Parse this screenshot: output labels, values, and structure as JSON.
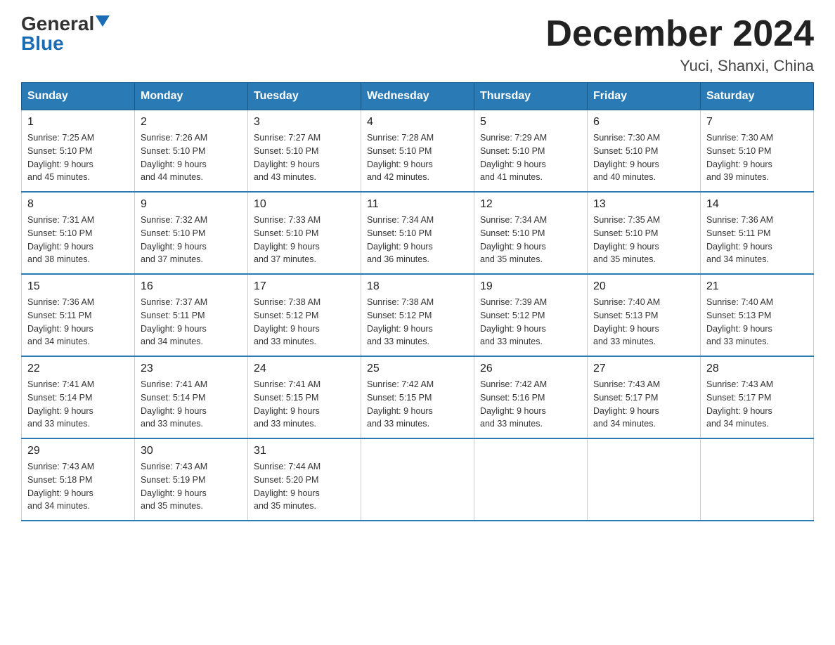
{
  "logo": {
    "general": "General",
    "blue": "Blue"
  },
  "title": {
    "month_year": "December 2024",
    "location": "Yuci, Shanxi, China"
  },
  "headers": [
    "Sunday",
    "Monday",
    "Tuesday",
    "Wednesday",
    "Thursday",
    "Friday",
    "Saturday"
  ],
  "weeks": [
    [
      {
        "day": "1",
        "sunrise": "7:25 AM",
        "sunset": "5:10 PM",
        "daylight": "9 hours and 45 minutes."
      },
      {
        "day": "2",
        "sunrise": "7:26 AM",
        "sunset": "5:10 PM",
        "daylight": "9 hours and 44 minutes."
      },
      {
        "day": "3",
        "sunrise": "7:27 AM",
        "sunset": "5:10 PM",
        "daylight": "9 hours and 43 minutes."
      },
      {
        "day": "4",
        "sunrise": "7:28 AM",
        "sunset": "5:10 PM",
        "daylight": "9 hours and 42 minutes."
      },
      {
        "day": "5",
        "sunrise": "7:29 AM",
        "sunset": "5:10 PM",
        "daylight": "9 hours and 41 minutes."
      },
      {
        "day": "6",
        "sunrise": "7:30 AM",
        "sunset": "5:10 PM",
        "daylight": "9 hours and 40 minutes."
      },
      {
        "day": "7",
        "sunrise": "7:30 AM",
        "sunset": "5:10 PM",
        "daylight": "9 hours and 39 minutes."
      }
    ],
    [
      {
        "day": "8",
        "sunrise": "7:31 AM",
        "sunset": "5:10 PM",
        "daylight": "9 hours and 38 minutes."
      },
      {
        "day": "9",
        "sunrise": "7:32 AM",
        "sunset": "5:10 PM",
        "daylight": "9 hours and 37 minutes."
      },
      {
        "day": "10",
        "sunrise": "7:33 AM",
        "sunset": "5:10 PM",
        "daylight": "9 hours and 37 minutes."
      },
      {
        "day": "11",
        "sunrise": "7:34 AM",
        "sunset": "5:10 PM",
        "daylight": "9 hours and 36 minutes."
      },
      {
        "day": "12",
        "sunrise": "7:34 AM",
        "sunset": "5:10 PM",
        "daylight": "9 hours and 35 minutes."
      },
      {
        "day": "13",
        "sunrise": "7:35 AM",
        "sunset": "5:10 PM",
        "daylight": "9 hours and 35 minutes."
      },
      {
        "day": "14",
        "sunrise": "7:36 AM",
        "sunset": "5:11 PM",
        "daylight": "9 hours and 34 minutes."
      }
    ],
    [
      {
        "day": "15",
        "sunrise": "7:36 AM",
        "sunset": "5:11 PM",
        "daylight": "9 hours and 34 minutes."
      },
      {
        "day": "16",
        "sunrise": "7:37 AM",
        "sunset": "5:11 PM",
        "daylight": "9 hours and 34 minutes."
      },
      {
        "day": "17",
        "sunrise": "7:38 AM",
        "sunset": "5:12 PM",
        "daylight": "9 hours and 33 minutes."
      },
      {
        "day": "18",
        "sunrise": "7:38 AM",
        "sunset": "5:12 PM",
        "daylight": "9 hours and 33 minutes."
      },
      {
        "day": "19",
        "sunrise": "7:39 AM",
        "sunset": "5:12 PM",
        "daylight": "9 hours and 33 minutes."
      },
      {
        "day": "20",
        "sunrise": "7:40 AM",
        "sunset": "5:13 PM",
        "daylight": "9 hours and 33 minutes."
      },
      {
        "day": "21",
        "sunrise": "7:40 AM",
        "sunset": "5:13 PM",
        "daylight": "9 hours and 33 minutes."
      }
    ],
    [
      {
        "day": "22",
        "sunrise": "7:41 AM",
        "sunset": "5:14 PM",
        "daylight": "9 hours and 33 minutes."
      },
      {
        "day": "23",
        "sunrise": "7:41 AM",
        "sunset": "5:14 PM",
        "daylight": "9 hours and 33 minutes."
      },
      {
        "day": "24",
        "sunrise": "7:41 AM",
        "sunset": "5:15 PM",
        "daylight": "9 hours and 33 minutes."
      },
      {
        "day": "25",
        "sunrise": "7:42 AM",
        "sunset": "5:15 PM",
        "daylight": "9 hours and 33 minutes."
      },
      {
        "day": "26",
        "sunrise": "7:42 AM",
        "sunset": "5:16 PM",
        "daylight": "9 hours and 33 minutes."
      },
      {
        "day": "27",
        "sunrise": "7:43 AM",
        "sunset": "5:17 PM",
        "daylight": "9 hours and 34 minutes."
      },
      {
        "day": "28",
        "sunrise": "7:43 AM",
        "sunset": "5:17 PM",
        "daylight": "9 hours and 34 minutes."
      }
    ],
    [
      {
        "day": "29",
        "sunrise": "7:43 AM",
        "sunset": "5:18 PM",
        "daylight": "9 hours and 34 minutes."
      },
      {
        "day": "30",
        "sunrise": "7:43 AM",
        "sunset": "5:19 PM",
        "daylight": "9 hours and 35 minutes."
      },
      {
        "day": "31",
        "sunrise": "7:44 AM",
        "sunset": "5:20 PM",
        "daylight": "9 hours and 35 minutes."
      },
      null,
      null,
      null,
      null
    ]
  ]
}
